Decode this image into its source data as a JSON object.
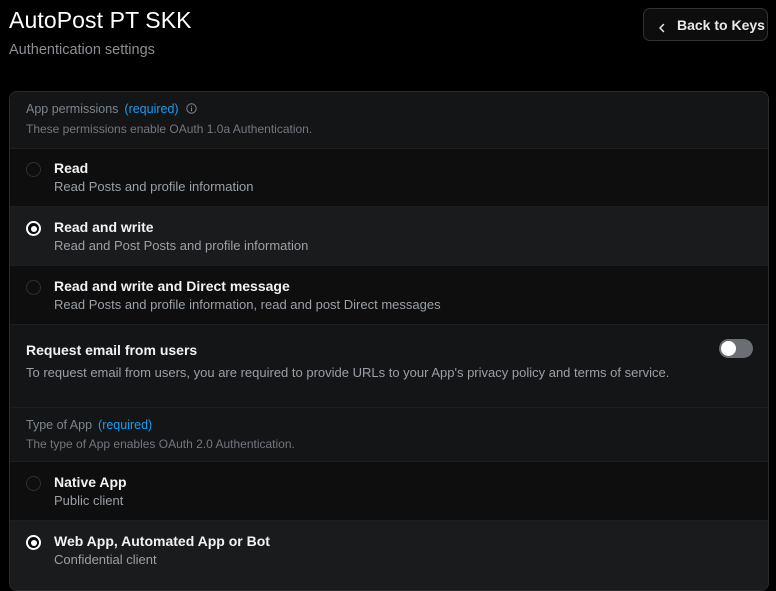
{
  "header": {
    "title": "AutoPost PT SKK",
    "subtitle": "Authentication settings",
    "back_button_label": "Back to Keys"
  },
  "app_permissions": {
    "label": "App permissions",
    "required": "(required)",
    "description": "These permissions enable OAuth 1.0a Authentication.",
    "options": [
      {
        "title": "Read",
        "description": "Read Posts and profile information",
        "selected": false
      },
      {
        "title": "Read and write",
        "description": "Read and Post Posts and profile information",
        "selected": true
      },
      {
        "title": "Read and write and Direct message",
        "description": "Read Posts and profile information, read and post Direct messages",
        "selected": false
      }
    ]
  },
  "request_email": {
    "title": "Request email from users",
    "description": "To request email from users, you are required to provide URLs to your App's privacy policy and terms of service.",
    "enabled": false
  },
  "type_of_app": {
    "label": "Type of App",
    "required": "(required)",
    "description": "The type of App enables OAuth 2.0 Authentication.",
    "options": [
      {
        "title": "Native App",
        "description": "Public client",
        "selected": false
      },
      {
        "title": "Web App, Automated App or Bot",
        "description": "Confidential client",
        "selected": true
      }
    ]
  },
  "colors": {
    "accent": "#1d9bf0",
    "background": "#000000",
    "panel": "#111214"
  },
  "icons": [
    "chevron-left-icon",
    "info-icon"
  ]
}
